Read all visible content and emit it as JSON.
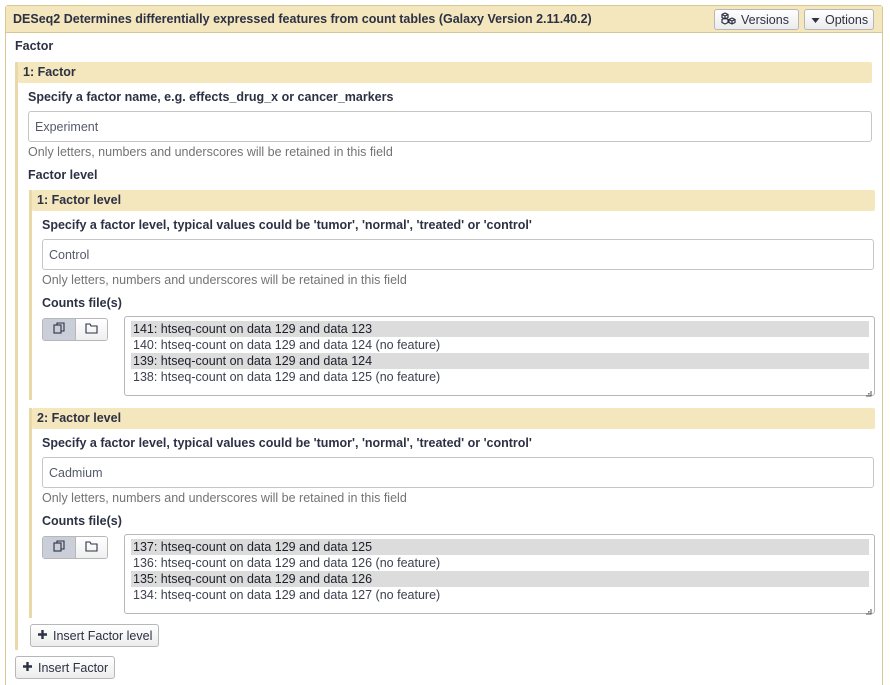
{
  "tool": {
    "title": "DESeq2 Determines differentially expressed features from count tables (Galaxy Version 2.11.40.2)",
    "versions_label": "Versions",
    "options_label": "Options"
  },
  "factor_section": {
    "title": "Factor",
    "repeat_header": "1: Factor",
    "name_label": "Specify a factor name, e.g. effects_drug_x or cancer_markers",
    "name_value": "Experiment",
    "name_help": "Only letters, numbers and underscores will be retained in this field",
    "level_section_title": "Factor level",
    "levels": [
      {
        "header": "1: Factor level",
        "label": "Specify a factor level, typical values could be 'tumor', 'normal', 'treated' or 'control'",
        "value": "Control",
        "help": "Only letters, numbers and underscores will be retained in this field",
        "counts_label": "Counts file(s)",
        "files": [
          {
            "text": "141: htseq-count on data 129 and data 123",
            "selected": true
          },
          {
            "text": "140: htseq-count on data 129 and data 124 (no feature)",
            "selected": false
          },
          {
            "text": "139: htseq-count on data 129 and data 124",
            "selected": true
          },
          {
            "text": "138: htseq-count on data 129 and data 125 (no feature)",
            "selected": false
          }
        ]
      },
      {
        "header": "2: Factor level",
        "label": "Specify a factor level, typical values could be 'tumor', 'normal', 'treated' or 'control'",
        "value": "Cadmium",
        "help": "Only letters, numbers and underscores will be retained in this field",
        "counts_label": "Counts file(s)",
        "files": [
          {
            "text": "137: htseq-count on data 129 and data 125",
            "selected": true
          },
          {
            "text": "136: htseq-count on data 129 and data 126 (no feature)",
            "selected": false
          },
          {
            "text": "135: htseq-count on data 129 and data 126",
            "selected": true
          },
          {
            "text": "134: htseq-count on data 129 and data 127 (no feature)",
            "selected": false
          }
        ]
      }
    ],
    "insert_level_label": "Insert Factor level"
  },
  "insert_factor_label": "Insert Factor",
  "colors": {
    "header_bg": "#f4e6bd",
    "header_border": "#d7c793",
    "selected_row": "#dcdcdc"
  }
}
